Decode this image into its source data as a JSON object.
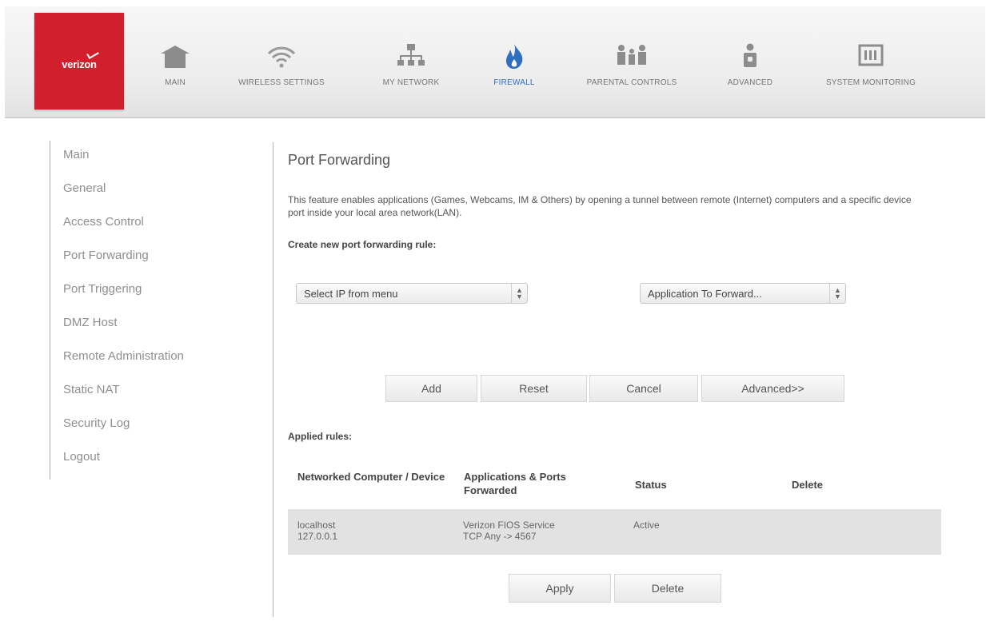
{
  "brand": {
    "logo_text": "verizon",
    "color": "#d21f2d"
  },
  "nav": {
    "active_color": "#2f6fc2",
    "items": [
      {
        "label": "MAIN",
        "icon": "home-icon"
      },
      {
        "label": "WIRELESS SETTINGS",
        "icon": "wifi-icon"
      },
      {
        "label": "MY NETWORK",
        "icon": "network-icon"
      },
      {
        "label": "FIREWALL",
        "icon": "flame-icon",
        "active": true
      },
      {
        "label": "PARENTAL CONTROLS",
        "icon": "family-icon"
      },
      {
        "label": "ADVANCED",
        "icon": "person-lock-icon"
      },
      {
        "label": "SYSTEM MONITORING",
        "icon": "monitor-icon"
      }
    ]
  },
  "sidebar": {
    "items": [
      {
        "label": "Main"
      },
      {
        "label": "General"
      },
      {
        "label": "Access Control"
      },
      {
        "label": "Port Forwarding"
      },
      {
        "label": "Port Triggering"
      },
      {
        "label": "DMZ Host"
      },
      {
        "label": "Remote Administration"
      },
      {
        "label": "Static NAT"
      },
      {
        "label": "Security Log"
      },
      {
        "label": "Logout"
      }
    ]
  },
  "main": {
    "title": "Port Forwarding",
    "description": "This feature enables applications (Games, Webcams, IM & Others) by opening a tunnel between remote (Internet) computers and a specific device port inside your local area network(LAN).",
    "create_label": "Create new port forwarding rule:",
    "ip_select": {
      "value": "Select IP from menu"
    },
    "app_select": {
      "value": "Application To Forward..."
    },
    "buttons": {
      "add": "Add",
      "reset": "Reset",
      "cancel": "Cancel",
      "advanced": "Advanced>>"
    },
    "applied_label": "Applied rules:",
    "table": {
      "headers": [
        "Networked Computer / Device",
        "Applications & Ports Forwarded",
        "Status",
        "Delete"
      ],
      "rows": [
        {
          "device_name": "localhost",
          "device_ip": "127.0.0.1",
          "app_name": "Verizon FIOS Service",
          "app_ports": "TCP Any -> 4567",
          "status": "Active"
        }
      ]
    },
    "apply_button": "Apply",
    "delete_button": "Delete"
  }
}
